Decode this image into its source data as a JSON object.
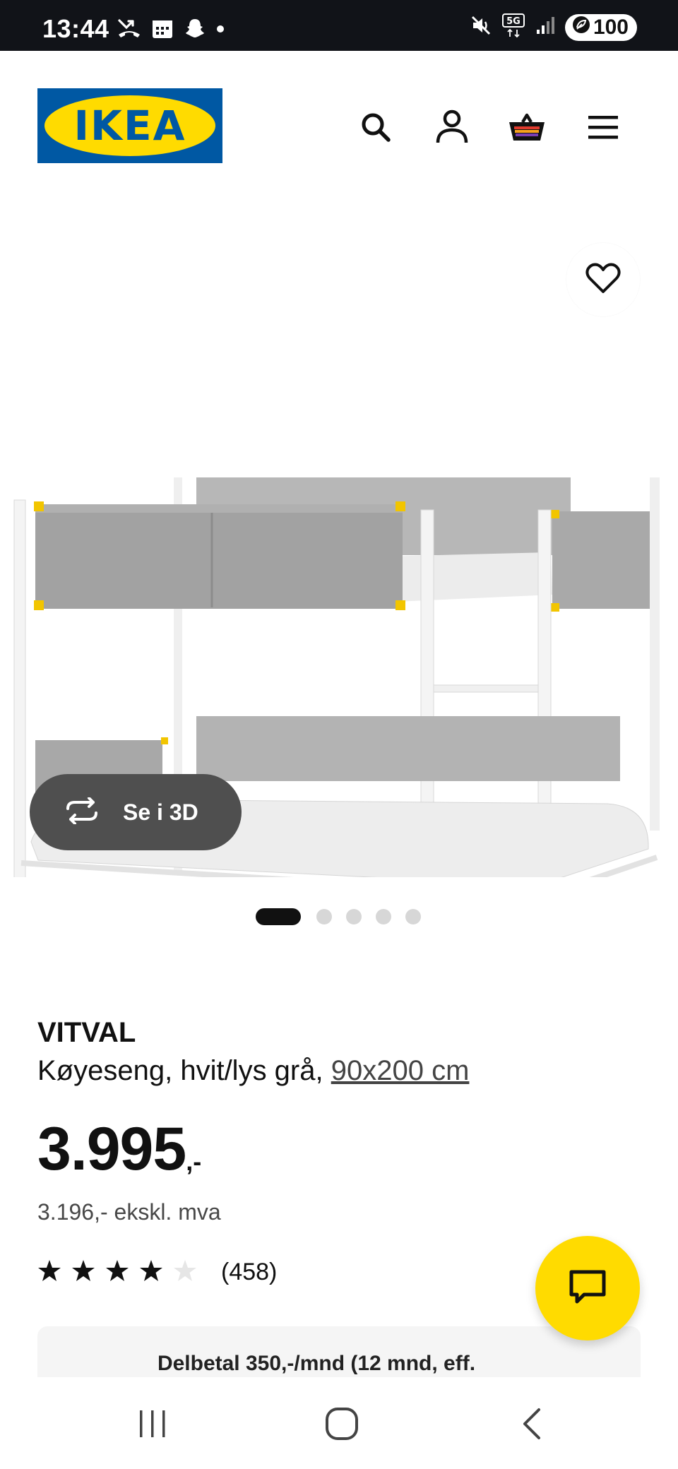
{
  "status": {
    "time": "13:44",
    "network": "5G",
    "battery": "100"
  },
  "header": {
    "logo_text": "IKEA",
    "brand_blue": "#0058a3",
    "brand_yellow": "#ffdb00",
    "icons": [
      "search-icon",
      "account-icon",
      "cart-icon",
      "menu-icon"
    ]
  },
  "gallery": {
    "view_3d_label": "Se i 3D",
    "image_count": 5,
    "active_index": 0
  },
  "product": {
    "name": "VITVAL",
    "description": "Køyeseng, hvit/lys grå,",
    "size_link": "90x200 cm",
    "price_main": "3.995",
    "price_suffix": ",-",
    "price_ex_vat": "3.196,- ekskl. mva",
    "rating_value": 4,
    "rating_max": 5,
    "review_count": "(458)"
  },
  "installment": {
    "text": "Delbetal 350,-/mnd (12 mnd, eff."
  }
}
